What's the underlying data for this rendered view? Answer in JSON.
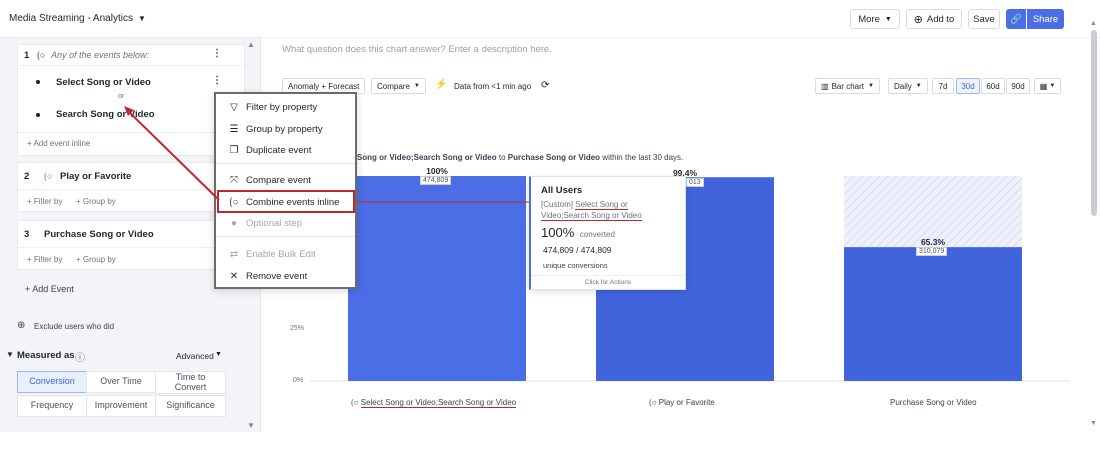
{
  "project": {
    "title": "Media Streaming - Analytics"
  },
  "events": {
    "step1": {
      "number": "1",
      "any_label": "Any of the events below:",
      "item1": "Select Song or Video",
      "or_label": "or",
      "item2": "Search Song or Video",
      "add_inline": "+ Add event inline"
    },
    "step2": {
      "number": "2",
      "title": "Play or Favorite",
      "filter": "+ Filter by",
      "group": "+ Group by"
    },
    "step3": {
      "number": "3",
      "title": "Purchase Song or Video",
      "filter": "+ Filter by",
      "group": "+ Group by"
    },
    "add_event": "+ Add Event",
    "exclude": "Exclude users who did"
  },
  "measured": {
    "title": "Measured as",
    "advanced": "Advanced",
    "options": [
      "Conversion",
      "Over Time",
      "Time to Convert",
      "Frequency",
      "Improvement",
      "Significance"
    ],
    "active": "Conversion"
  },
  "context_menu": {
    "items": [
      {
        "label": "Filter by property",
        "icon": "filter-icon"
      },
      {
        "label": "Group by property",
        "icon": "group-icon"
      },
      {
        "label": "Duplicate event",
        "icon": "duplicate-icon"
      },
      {
        "label": "Compare event",
        "icon": "compare-icon"
      },
      {
        "label": "Combine events inline",
        "icon": "combine-icon"
      },
      {
        "label": "Optional step",
        "icon": "optional-icon"
      },
      {
        "label": "Enable Bulk Edit",
        "icon": "bulk-edit-icon"
      },
      {
        "label": "Remove event",
        "icon": "close-icon"
      }
    ]
  },
  "toolbar": {
    "more": "More",
    "add_to": "Add to",
    "save": "Save",
    "share": "Share"
  },
  "chart": {
    "description_placeholder": "What question does this chart answer? Enter a description here.",
    "anomaly": "Anomaly + Forecast",
    "compare": "Compare",
    "data_from": "Data from <1 min ago",
    "chart_type": "Bar chart",
    "interval": "Daily",
    "ranges": [
      "7d",
      "30d",
      "60d",
      "90d"
    ],
    "active_range": "30d",
    "subtitle": {
      "prefix": "t Song or Video;Search Song or Video",
      "to": " to ",
      "target": "Purchase Song or Video",
      "suffix": " within the last 30 days."
    },
    "bar1_pct": "100%",
    "bar1_count": "474,809",
    "bar2_pct": "99.4%",
    "bar2_count": "013",
    "bar3_pct": "65.3%",
    "bar3_count": "310,079",
    "y_ticks": [
      "25%",
      "0%"
    ],
    "x_labels": [
      "Select Song or Video;Search Song or Video",
      "Play or Favorite",
      "Purchase Song or Video"
    ]
  },
  "chart_data": {
    "type": "bar",
    "categories": [
      "Select Song or Video;Search Song or Video",
      "Play or Favorite",
      "Purchase Song or Video"
    ],
    "values": [
      100,
      99.4,
      65.3
    ],
    "counts": [
      474809,
      null,
      310079
    ],
    "ylim": [
      0,
      100
    ],
    "colors": {
      "bar": "#4b6ee6",
      "bar_dark": "#4163dc"
    }
  },
  "tooltip": {
    "title": "All Users",
    "event_prefix": "[Custom] ",
    "event_line1": "Select Song or",
    "event_line2": "Video;Search Song or Video",
    "pct": "100%",
    "pct_label": "converted",
    "ratio": "474,809 / 474,809",
    "unique": "unique conversions",
    "actions": "Click for Actions"
  }
}
